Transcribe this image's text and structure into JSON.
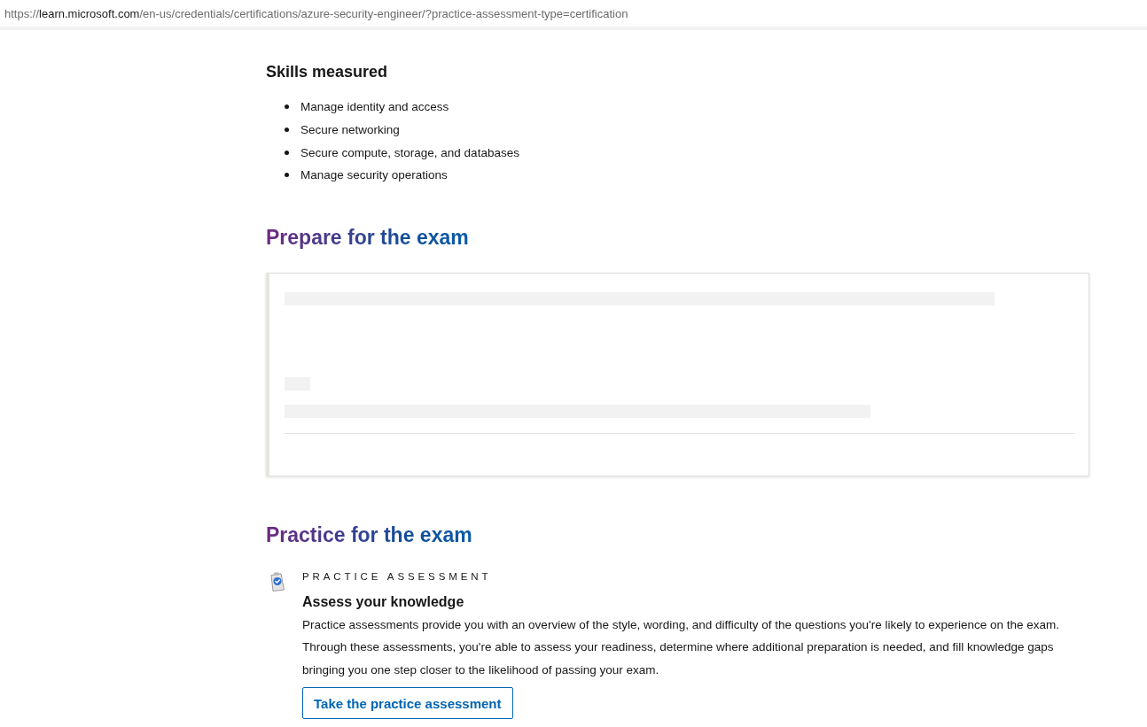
{
  "address_bar": {
    "scheme": "https://",
    "host": "learn.microsoft.com",
    "path": "/en-us/credentials/certifications/azure-security-engineer/?practice-assessment-type=certification"
  },
  "skills": {
    "title": "Skills measured",
    "items": [
      "Manage identity and access",
      "Secure networking",
      "Secure compute, storage, and databases",
      "Manage security operations"
    ]
  },
  "prepare": {
    "title": "Prepare for the exam",
    "card": {
      "loading": true
    }
  },
  "practice": {
    "title": "Practice for the exam",
    "eyebrow": "PRACTICE ASSESSMENT",
    "heading": "Assess your knowledge",
    "description": "Practice assessments provide you with an overview of the style, wording, and difficulty of the questions you're likely to experience on the exam. Through these assessments, you're able to assess your readiness, determine where additional preparation is needed, and fill knowledge gaps bringing you one step closer to the likelihood of passing your exam.",
    "button": "Take the practice assessment"
  }
}
